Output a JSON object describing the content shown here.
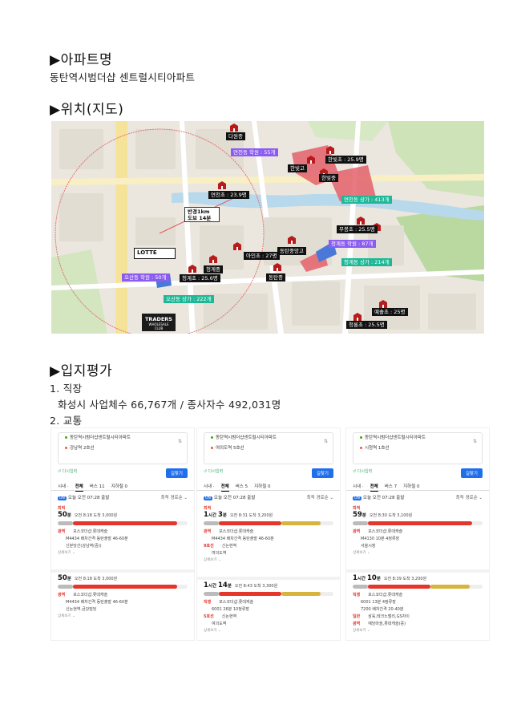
{
  "sections": {
    "apt_heading": "▶아파트명",
    "apt_name": "동탄역시범더샵 센트럴시티아파트",
    "location_heading": "▶위치(지도)",
    "eval_heading": "▶입지평가",
    "item1_title": "1. 직장",
    "item1_text": "화성시 사업체수 66,767개 / 종사자수 492,031명",
    "item2_title": "2. 교통"
  },
  "map": {
    "labels": {
      "dawon": "다원중",
      "yeoncheon_academy": "연천동 학원 : 55개",
      "hanbitgo": "한빛고",
      "hanbitcho": "한빛초 : 25.9명",
      "hanbitjung": "한빛중",
      "yeoncheon_mall": "연천동 상가 : 413개",
      "yecheon": "연천초 : 23.9명",
      "radius1": "반경1km",
      "radius2": "도보 14분",
      "mubong": "무봉초 : 25.5명",
      "cheonggye_academy": "청계동 학원 : 87개",
      "dongtan_jungang": "동탄중앙고",
      "cheonggye_mall": "청계동 상가 : 214개",
      "achoncho": "아인초 : 27명",
      "cheonggyejung": "청계중",
      "cheonggyecho": "청계초 : 25.6명",
      "dongtanjung": "동탄중",
      "osan_academy": "오산동 학원 : 50개",
      "osan_mall": "오산동 상가 : 222개",
      "yesolcho": "예솔초 : 25명",
      "cheongryucho": "청룡초 : 25.5명",
      "lotte": "LOTTE",
      "traders": "TRADERS",
      "traders_sub": "WHOLESALE CLUB"
    }
  },
  "panels": [
    {
      "from": "동탄역시범더샵센트럴시티아파트",
      "to": "강남역 2호선",
      "register": "다시입력",
      "go": "길찾기",
      "tabs": [
        "전체",
        "버스 11",
        "지하철 0"
      ],
      "dep": "오늘 오전 07:28 출발",
      "sort": "최적 경로순",
      "routes": [
        {
          "best": "최적",
          "hours": "",
          "mins": "50",
          "meta": "오전 8:18 도착  3,000원",
          "steps": [
            {
              "badge": "광역",
              "text": "포스코더샵.롯데캐슬"
            },
            {
              "badge": "",
              "text": "M4434 배차간격 동탄출발 46-60분"
            },
            {
              "badge": "",
              "text": "신분당선(강남역(중))"
            }
          ]
        },
        {
          "best": "",
          "hours": "",
          "mins": "50",
          "meta": "오전 8:18 도착  3,000원",
          "steps": [
            {
              "badge": "광역",
              "text": "포스코더샵.롯데캐슬"
            },
            {
              "badge": "",
              "text": "M4434 배차간격 동탄출발 46-60분"
            },
            {
              "badge": "",
              "text": "신논현역.금강빌딩"
            }
          ]
        }
      ]
    },
    {
      "from": "동탄역시범더샵센트럴시티아파트",
      "to": "여의도역 5호선",
      "register": "다시입력",
      "go": "길찾기",
      "tabs": [
        "전체",
        "버스 5",
        "지하철 0"
      ],
      "dep": "오늘 오전 07:28 출발",
      "sort": "최적 경로순",
      "routes": [
        {
          "best": "최적",
          "hours": "1",
          "mins": "3",
          "meta": "오전 8:31 도착  3,200원",
          "steps": [
            {
              "badge": "광역",
              "text": "포스코더샵.롯데캐슬"
            },
            {
              "badge": "",
              "text": "M4434 배차간격 동탄출발 46-60분"
            },
            {
              "badge": "9호선",
              "text": "신논현역"
            },
            {
              "badge": "",
              "text": "여의도역"
            }
          ]
        },
        {
          "best": "",
          "hours": "1",
          "mins": "14",
          "meta": "오전 8:43 도착  3,300원",
          "steps": [
            {
              "badge": "직행",
              "text": "포스코더샵.롯데캐슬"
            },
            {
              "badge": "",
              "text": "6001 26분 10정류장"
            },
            {
              "badge": "5호선",
              "text": "신논현역"
            },
            {
              "badge": "",
              "text": "여의도역"
            }
          ]
        }
      ]
    },
    {
      "from": "동탄역시범더샵센트럴시티아파트",
      "to": "시청역 1호선",
      "register": "다시입력",
      "go": "길찾기",
      "tabs": [
        "전체",
        "버스 7",
        "지하철 0"
      ],
      "dep": "오늘 오전 07:28 출발",
      "sort": "최적 경로순",
      "routes": [
        {
          "best": "최적",
          "hours": "",
          "mins": "59",
          "meta": "오전 8:30 도착  3,100원",
          "steps": [
            {
              "badge": "광역",
              "text": "포스코더샵.롯데캐슬"
            },
            {
              "badge": "",
              "text": "M4130 10분 4정류장"
            },
            {
              "badge": "",
              "text": "서울시청"
            }
          ]
        },
        {
          "best": "",
          "hours": "1",
          "mins": "10",
          "meta": "오전 8:39 도착  3,200원",
          "steps": [
            {
              "badge": "직행",
              "text": "포스코더샵.롯데캐슬"
            },
            {
              "badge": "",
              "text": "6001 13분 4정류장"
            },
            {
              "badge": "",
              "text": "7200 배차간격 20-40분"
            },
            {
              "badge": "일반",
              "text": "삼육,테크노밸리,GS자이"
            },
            {
              "badge": "광역",
              "text": "예당마을,롯데캐슬(중)"
            }
          ]
        }
      ]
    }
  ],
  "colors": {
    "purple": "#8a5cf0",
    "green": "#1fb896",
    "route_red": "#e4362b",
    "bus_blue": "#1f6feb"
  }
}
